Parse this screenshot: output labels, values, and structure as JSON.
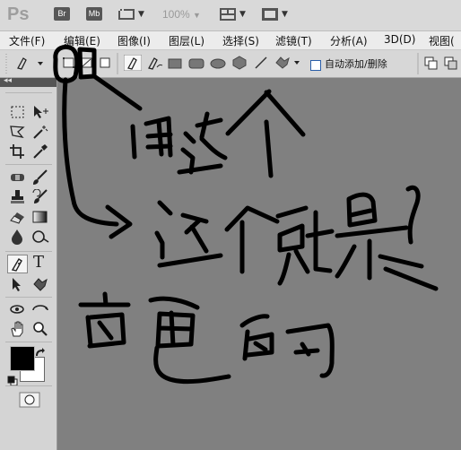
{
  "app": {
    "logo_text": "Ps",
    "bridge_button": "Br",
    "minibridge_button": "Mb",
    "zoom_level": "100%"
  },
  "menu": {
    "items": [
      "文件(F)",
      "编辑(E)",
      "图像(I)",
      "图层(L)",
      "选择(S)",
      "滤镜(T)",
      "分析(A)",
      "3D(D)",
      "视图("
    ]
  },
  "options_bar": {
    "auto_add_delete_label": "自动添加/删除",
    "auto_add_delete_checked": false
  },
  "tools_panel": {
    "collapse_label": "◂◂",
    "text_tool_glyph": "T",
    "foreground_color": "#000000",
    "background_color": "#ffffff"
  },
  "annotation": {
    "stroke_color": "#000000"
  }
}
